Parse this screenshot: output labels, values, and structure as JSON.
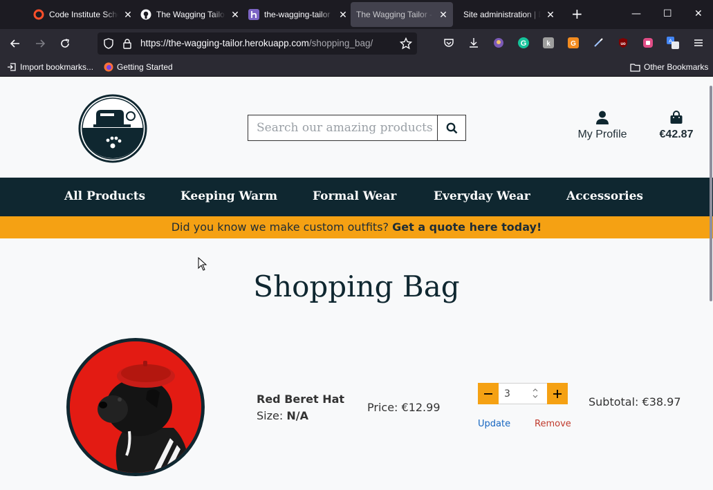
{
  "browser": {
    "tabs": [
      {
        "title": "Code Institute School",
        "favicon": "code-institute-icon"
      },
      {
        "title": "The Wagging Tailor",
        "favicon": "github-icon"
      },
      {
        "title": "the-wagging-tailor",
        "favicon": "heroku-icon"
      },
      {
        "title": "The Wagging Tailor - Shopping Bag",
        "favicon": "",
        "active": true
      },
      {
        "title": "Site administration | Django",
        "favicon": ""
      }
    ],
    "url_host": "https://the-wagging-tailor.herokuapp.com",
    "url_path": "/shopping_bag/",
    "bookmarks": {
      "import": "Import bookmarks...",
      "getting_started": "Getting Started",
      "other": "Other Bookmarks"
    }
  },
  "header": {
    "search_placeholder": "Search our amazing products",
    "profile_label": "My Profile",
    "bag_total": "€42.87"
  },
  "nav": {
    "items": [
      "All Products",
      "Keeping Warm",
      "Formal Wear",
      "Everyday Wear",
      "Accessories"
    ]
  },
  "banner": {
    "text": "Did you know we make custom outfits?",
    "link": "Get a quote here today!"
  },
  "bag": {
    "heading": "Shopping Bag",
    "item": {
      "name": "Red Beret Hat",
      "size_label": "Size:",
      "size_value": "N/A",
      "price": "Price: €12.99",
      "quantity": "3",
      "update_label": "Update",
      "remove_label": "Remove",
      "subtotal": "Subtotal: €38.97"
    }
  },
  "colors": {
    "navy": "#0f2730",
    "accent": "#f5a113",
    "hat_red": "#e31b13"
  }
}
